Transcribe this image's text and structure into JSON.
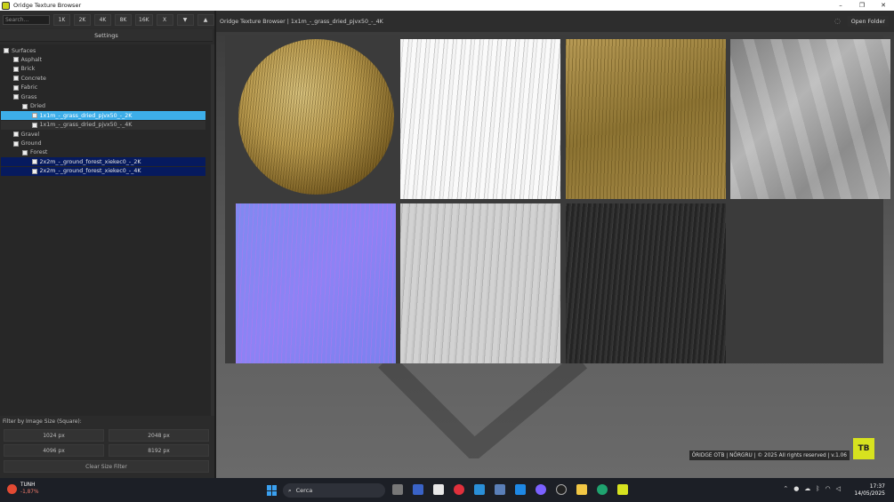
{
  "window": {
    "title": "Oridge Texture Browser",
    "controls": [
      "–",
      "❐",
      "✕"
    ]
  },
  "toolbar": {
    "search_placeholder": "Search...",
    "resolutions": [
      "1K",
      "2K",
      "4K",
      "8K",
      "16K"
    ],
    "clear_label": "X",
    "down_arrow": "▼",
    "up_arrow": "▲"
  },
  "settings": {
    "label": "Settings"
  },
  "tree": [
    {
      "label": "Surfaces",
      "indent": 0,
      "state": "normal"
    },
    {
      "label": "Asphalt",
      "indent": 1,
      "state": "normal"
    },
    {
      "label": "Brick",
      "indent": 1,
      "state": "normal"
    },
    {
      "label": "Concrete",
      "indent": 1,
      "state": "normal"
    },
    {
      "label": "Fabric",
      "indent": 1,
      "state": "normal"
    },
    {
      "label": "Grass",
      "indent": 1,
      "state": "normal"
    },
    {
      "label": "Dried",
      "indent": 2,
      "state": "normal"
    },
    {
      "label": "1x1m_-_grass_dried_pjvx50_-_2K",
      "indent": 3,
      "state": "selected"
    },
    {
      "label": "1x1m_-_grass_dried_pjvx50_-_4K",
      "indent": 3,
      "state": "odd"
    },
    {
      "label": "Gravel",
      "indent": 1,
      "state": "normal"
    },
    {
      "label": "Ground",
      "indent": 1,
      "state": "normal"
    },
    {
      "label": "Forest",
      "indent": 2,
      "state": "normal"
    },
    {
      "label": "2x2m_-_ground_forest_xiekec0_-_2K",
      "indent": 3,
      "state": "highlight"
    },
    {
      "label": "2x2m_-_ground_forest_xiekec0_-_4K",
      "indent": 3,
      "state": "highlight"
    }
  ],
  "filter": {
    "label": "Filter by Image Size (Square):",
    "sizes": [
      "1024 px",
      "2048 px",
      "4096 px",
      "8192 px"
    ],
    "clear": "Clear Size Filter"
  },
  "header": {
    "path": "Oridge Texture Browser | 1x1m_-_grass_dried_pjvx50_-_4K",
    "open_folder": "Open Folder"
  },
  "footer": {
    "text": "ÖRIDGE OTB | NÖRGRU | © 2025 All rights reserved | v.1.06",
    "logo_text": "TB"
  },
  "taskbar": {
    "weather_temp": "TUNH",
    "weather_change": "-1,87%",
    "search": "Cerca",
    "time": "17:37",
    "date": "14/05/2025"
  },
  "colors": {
    "selected": "#3daee9",
    "highlight": "#061a5e",
    "accent_logo": "#d7e21f"
  }
}
